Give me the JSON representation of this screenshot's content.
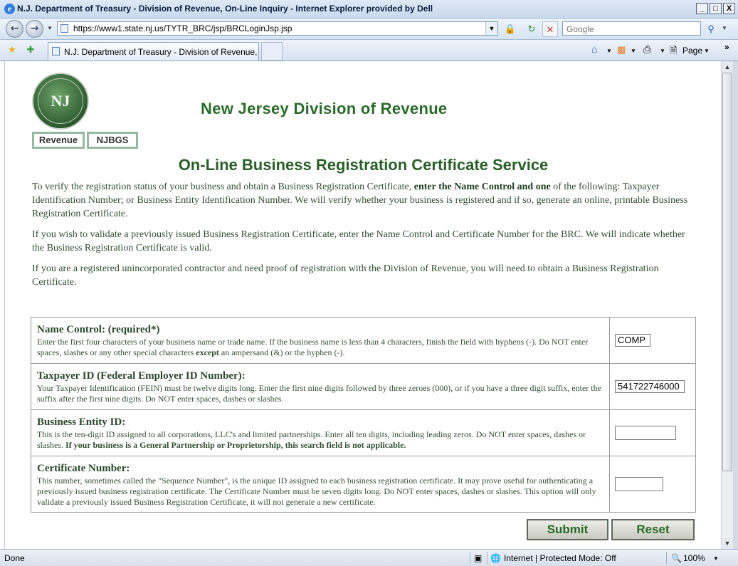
{
  "window": {
    "title": "N.J. Department of Treasury - Division of Revenue, On-Line Inquiry - Internet Explorer provided by Dell",
    "controls": [
      "_",
      "□",
      "X"
    ]
  },
  "navbar": {
    "back_icon": "back-arrow-icon",
    "forward_icon": "forward-arrow-icon",
    "url": "https://www1.state.nj.us/TYTR_BRC/jsp/BRCLoginJsp.jsp",
    "search_placeholder": "Google"
  },
  "tabs": {
    "active_tab": "N.J. Department of Treasury - Division of Revenue, O...",
    "page_menu": "Page"
  },
  "page": {
    "site_title": "New Jersey Division of Revenue",
    "nav": {
      "revenue": "Revenue",
      "njbgs": "NJBGS"
    },
    "logo_text": "NJ",
    "service_title": "On-Line Business Registration Certificate Service",
    "intro": {
      "p1_a": "To verify the registration status of your business and obtain a Business Registration Certificate, ",
      "p1_bold": "enter the Name Control and one",
      "p1_b": " of the following: Taxpayer Identification Number; or Business Entity Identification Number.  We will verify whether your business is registered and if so, generate an online, printable Business Registration Certificate.",
      "p2": "If you wish to validate a previously issued Business Registration Certificate, enter the Name Control and Certificate Number for the BRC.   We will indicate whether the Business Registration Certificate is valid.",
      "p3": "If you are a registered unincorporated contractor and need proof of registration with the Division of Revenue, you will need to obtain a Business Registration Certificate."
    },
    "fields": {
      "name_control": {
        "label": "Name Control: (required*)",
        "desc_a": "Enter the first four characters of your business name or trade name.   If the business name is less than 4 characters, finish the field with hyphens (-).   Do NOT enter spaces, slashes or any other special characters ",
        "desc_bold": "except",
        "desc_b": " an ampersand (&) or the hyphen (-).",
        "value": "COMP"
      },
      "taxpayer_id": {
        "label": "Taxpayer ID (Federal Employer ID Number):",
        "desc": "Your Taxpayer Identification (FEIN) must be twelve digits long.   Enter the first nine digits followed by three zeroes (000), or if you have a three digit suffix, enter the suffix after the first nine digits.   Do NOT enter spaces, dashes or slashes.",
        "value": "541722746000"
      },
      "business_entity_id": {
        "label": "Business Entity ID:",
        "desc_a": "This is the ten-digit ID assigned to all corporations, LLC's and limited partnerships. Enter all ten digits, including leading zeros.   Do NOT enter spaces, dashes or slashes.   ",
        "desc_bold": "If your business is a General Partnership or Proprietorship, this search field is not applicable.",
        "value": ""
      },
      "certificate_number": {
        "label": "Certificate Number:",
        "desc": "This number, sometimes called the \"Sequence Number\", is the unique ID assigned to each business registration certificate.   It may prove useful for authenticating a previously issued business registration certificate.   The Certificate Number must be seven digits long.   Do NOT enter spaces, dashes or slashes.   This option will only validate a previously issued Business Registration Certificate, it will not generate a new certificate.",
        "value": ""
      }
    },
    "buttons": {
      "submit": "Submit",
      "reset": "Reset"
    }
  },
  "statusbar": {
    "status": "Done",
    "zone": "Internet | Protected Mode: Off",
    "zoom": "100%"
  },
  "colors": {
    "heading_green": "#2a6a2a",
    "body_text": "#2f4f2f",
    "chrome_blue": "#c9d9ee"
  }
}
